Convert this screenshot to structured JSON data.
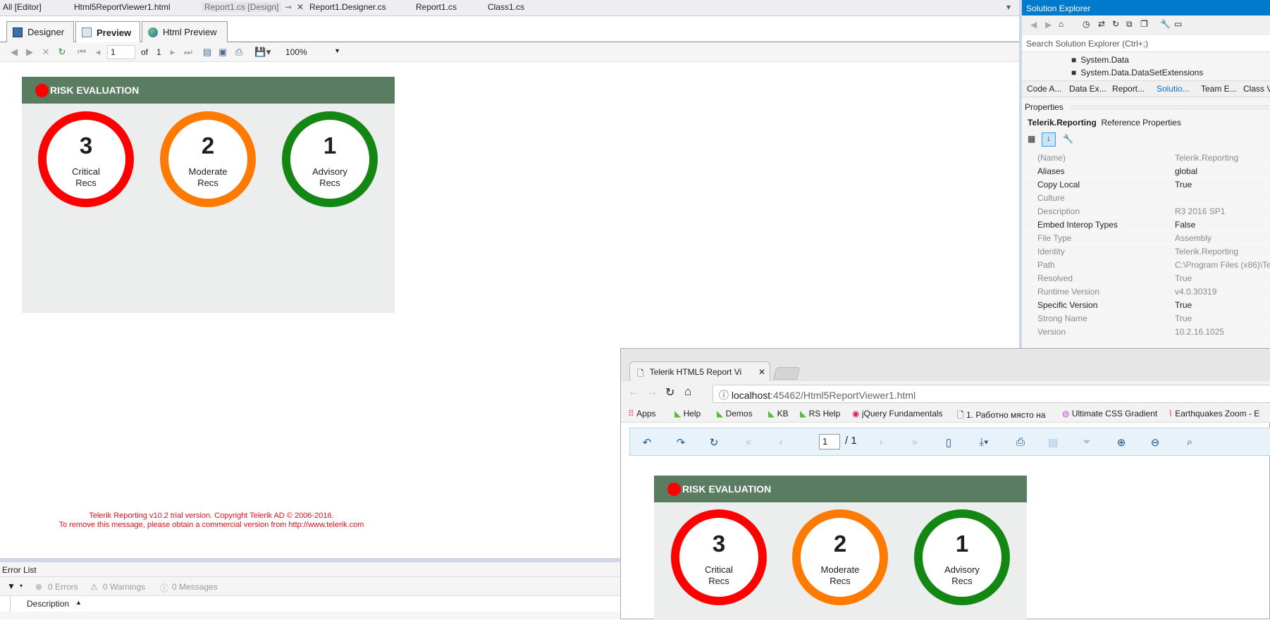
{
  "doc_tabs": [
    "All [Editor]",
    "Html5ReportViewer1.html",
    "Report1.cs [Design]",
    "Report1.Designer.cs",
    "Report1.cs",
    "Class1.cs"
  ],
  "view_tabs": {
    "designer": "Designer",
    "preview": "Preview",
    "html_preview": "Html Preview"
  },
  "report_toolbar": {
    "page": "1",
    "of_label": "of",
    "total": "1",
    "zoom": "100%"
  },
  "report": {
    "title": "RISK EVALUATION",
    "rings": [
      {
        "num": "3",
        "label": "Critical\nRecs",
        "color": "#ff0000"
      },
      {
        "num": "2",
        "label": "Moderate\nRecs",
        "color": "#ff7a00"
      },
      {
        "num": "1",
        "label": "Advisory\nRecs",
        "color": "#138613"
      }
    ]
  },
  "trial": {
    "line1": "Telerik Reporting v10.2 trial version. Copyright Telerik AD © 2006-2016.",
    "line2": "To remove this message, please obtain a commercial version from http://www.telerik.com"
  },
  "error_list": {
    "title": "Error List",
    "errors": "0 Errors",
    "warnings": "0 Warnings",
    "messages": "0 Messages",
    "description_col": "Description"
  },
  "solution_explorer": {
    "title": "Solution Explorer",
    "search_placeholder": "Search Solution Explorer (Ctrl+;)",
    "items": [
      "System.Data",
      "System.Data.DataSetExtensions"
    ],
    "tabs": [
      "Code A...",
      "Data Ex...",
      "Report...",
      "Solutio...",
      "Team E...",
      "Class Vi"
    ]
  },
  "properties": {
    "title": "Properties",
    "object": "Telerik.Reporting",
    "object_type": "Reference Properties",
    "rows": [
      {
        "name": "(Name)",
        "value": "Telerik.Reporting",
        "dim": true
      },
      {
        "name": "Aliases",
        "value": "global",
        "dim": false
      },
      {
        "name": "Copy Local",
        "value": "True",
        "dim": false
      },
      {
        "name": "Culture",
        "value": "",
        "dim": true
      },
      {
        "name": "Description",
        "value": "R3 2016 SP1",
        "dim": true
      },
      {
        "name": "Embed Interop Types",
        "value": "False",
        "dim": false
      },
      {
        "name": "File Type",
        "value": "Assembly",
        "dim": true
      },
      {
        "name": "Identity",
        "value": "Telerik.Reporting",
        "dim": true
      },
      {
        "name": "Path",
        "value": "C:\\Program Files (x86)\\Tel",
        "dim": true
      },
      {
        "name": "Resolved",
        "value": "True",
        "dim": true
      },
      {
        "name": "Runtime Version",
        "value": "v4.0.30319",
        "dim": true
      },
      {
        "name": "Specific Version",
        "value": "True",
        "dim": false
      },
      {
        "name": "Strong Name",
        "value": "True",
        "dim": true
      },
      {
        "name": "Version",
        "value": "10.2.16.1025",
        "dim": true
      }
    ]
  },
  "browser": {
    "tab_title": "Telerik HTML5 Report Vi",
    "url_host": "localhost",
    "url_rest": ":45462/Html5ReportViewer1.html",
    "bookmarks": [
      "Apps",
      "Help",
      "Demos",
      "KB",
      "RS Help",
      "jQuery Fundamentals",
      "1. Работно място на",
      "Ultimate CSS Gradient",
      "Earthquakes Zoom - E"
    ],
    "page": "1",
    "page_total": "/ 1"
  }
}
